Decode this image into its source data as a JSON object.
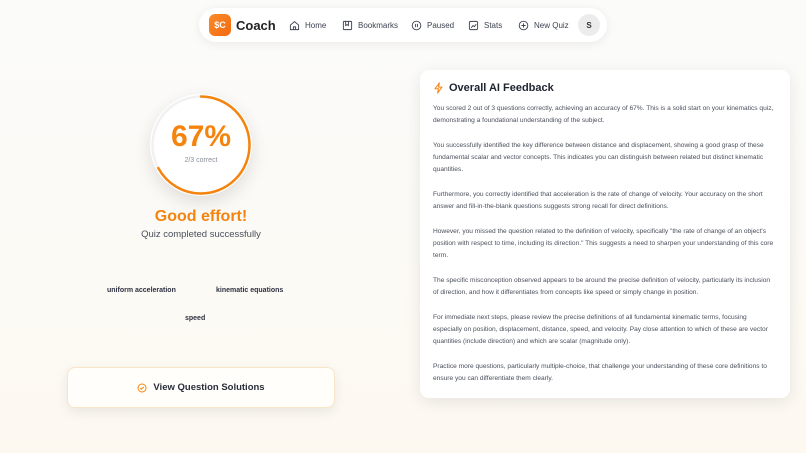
{
  "nav": {
    "brand_logo": "$C",
    "brand_name": "Coach",
    "items": [
      {
        "label": "Home",
        "icon": "home-icon"
      },
      {
        "label": "Bookmarks",
        "icon": "bookmark-icon"
      },
      {
        "label": "Paused",
        "icon": "pause-icon"
      },
      {
        "label": "Stats",
        "icon": "stats-icon"
      },
      {
        "label": "New Quiz",
        "icon": "plus-circle-icon"
      }
    ],
    "avatar_initial": "S"
  },
  "result": {
    "percent": "67%",
    "accuracy": 0.67,
    "correct_text": "2/3 correct",
    "title": "Good effort!",
    "subtitle": "Quiz completed successfully"
  },
  "topics": [
    "uniform acceleration",
    "kinematic equations",
    "speed"
  ],
  "solutions_button": {
    "label": "View Question Solutions",
    "icon": "check-circle-icon"
  },
  "feedback": {
    "title": "Overall AI Feedback",
    "icon": "lightning-icon",
    "paragraphs": [
      "You scored 2 out of 3 questions correctly, achieving an accuracy of 67%. This is a solid start on your kinematics quiz, demonstrating a foundational understanding of the subject.",
      "You successfully identified the key difference between distance and displacement, showing a good grasp of these fundamental scalar and vector concepts. This indicates you can distinguish between related but distinct kinematic quantities.",
      "Furthermore, you correctly identified that acceleration is the rate of change of velocity. Your accuracy on the short answer and fill-in-the-blank questions suggests strong recall for direct definitions.",
      "However, you missed the question related to the definition of velocity, specifically \"the rate of change of an object's position with respect to time, including its direction.\" This suggests a need to sharpen your understanding of this core term.",
      "The specific misconception observed appears to be around the precise definition of velocity, particularly its inclusion of direction, and how it differentiates from concepts like speed or simply change in position.",
      "For immediate next steps, please review the precise definitions of all fundamental kinematic terms, focusing especially on position, displacement, distance, speed, and velocity. Pay close attention to which of these are vector quantities (include direction) and which are scalar (magnitude only).",
      "Practice more questions, particularly multiple-choice, that challenge your understanding of these core definitions to ensure you can differentiate them clearly."
    ]
  },
  "colors": {
    "accent": "#f5840f",
    "ring_track": "#f1f1f1"
  }
}
